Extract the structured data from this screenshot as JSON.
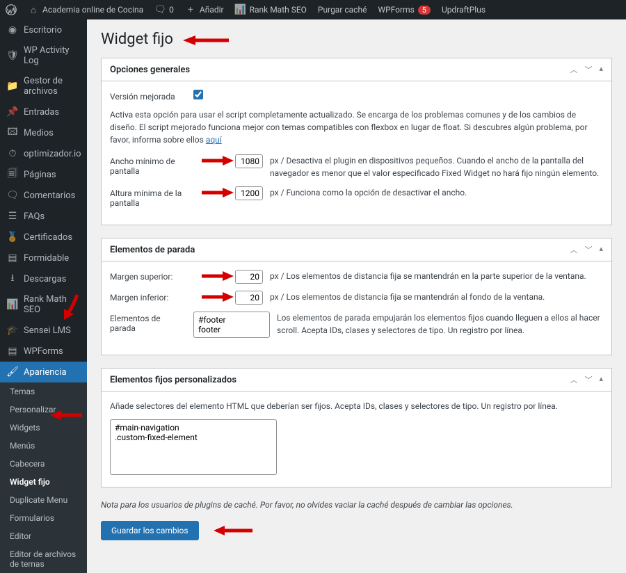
{
  "adminbar": {
    "site": "Academia online de Cocina",
    "comments": "0",
    "add": "Añadir",
    "rank": "Rank Math SEO",
    "purge": "Purgar caché",
    "wpforms": "WPForms",
    "wpforms_badge": "5",
    "updraft": "UpdraftPlus"
  },
  "sidebar": {
    "items": [
      {
        "label": "Escritorio"
      },
      {
        "label": "WP Activity Log"
      },
      {
        "label": "Gestor de archivos"
      },
      {
        "label": "Entradas"
      },
      {
        "label": "Medios"
      },
      {
        "label": "optimizador.io"
      },
      {
        "label": "Páginas"
      },
      {
        "label": "Comentarios"
      },
      {
        "label": "FAQs"
      },
      {
        "label": "Certificados"
      },
      {
        "label": "Formidable"
      },
      {
        "label": "Descargas"
      },
      {
        "label": "Rank Math SEO"
      },
      {
        "label": "Sensei LMS"
      },
      {
        "label": "WPForms"
      },
      {
        "label": "Apariencia"
      }
    ],
    "sub": [
      {
        "label": "Temas"
      },
      {
        "label": "Personalizar"
      },
      {
        "label": "Widgets"
      },
      {
        "label": "Menús"
      },
      {
        "label": "Cabecera"
      },
      {
        "label": "Widget fijo"
      },
      {
        "label": "Duplicate Menu"
      },
      {
        "label": "Formularios"
      },
      {
        "label": "Editor"
      },
      {
        "label": "Editor de archivos de temas"
      }
    ]
  },
  "page": {
    "title": "Widget fijo"
  },
  "panel1": {
    "title": "Opciones generales",
    "enhanced_label": "Versión mejorada",
    "enhanced_desc_pre": "Activa esta opción para usar el script completamente actualizado. Se encarga de los problemas comunes y de los cambios de diseño. El script mejorado funciona mejor con temas compatibles con flexbox en lugar de float. Si descubres algún problema, por favor, informa sobre ellos ",
    "enhanced_link": "aquí",
    "minw_label": "Ancho mínimo de pantalla",
    "minw_value": "1080",
    "minw_desc": "px / Desactiva el plugin en dispositivos pequeños. Cuando el ancho de la pantalla del navegador es menor que el valor especificado Fixed Widget no hará fijo ningún elemento.",
    "minh_label": "Altura mínima de la pantalla",
    "minh_value": "1200",
    "minh_desc": "px / Funciona como la opción de desactivar el ancho."
  },
  "panel2": {
    "title": "Elementos de parada",
    "mtop_label": "Margen superior:",
    "mtop_value": "20",
    "mtop_desc": "px / Los elementos de distancia fija se mantendrán en la parte superior de la ventana.",
    "mbot_label": "Margen inferior:",
    "mbot_value": "20",
    "mbot_desc": "px / Los elementos de distancia fija se mantendrán al fondo de la ventana.",
    "stop_label": "Elementos de parada",
    "stop_value": "#footer\nfooter",
    "stop_desc": "Los elementos de parada empujarán los elementos fijos cuando lleguen a ellos al hacer scroll. Acepta IDs, clases y selectores de tipo. Un registro por línea."
  },
  "panel3": {
    "title": "Elementos fijos personalizados",
    "desc": "Añade selectores del elemento HTML que deberían ser fijos. Acepta IDs, clases y selectores de tipo. Un registro por línea.",
    "value": "#main-navigation\n.custom-fixed-element"
  },
  "note": "Nota para los usuarios de plugins de caché. Por favor, no olvides vaciar la caché después de cambiar las opciones.",
  "save": "Guardar los cambios"
}
